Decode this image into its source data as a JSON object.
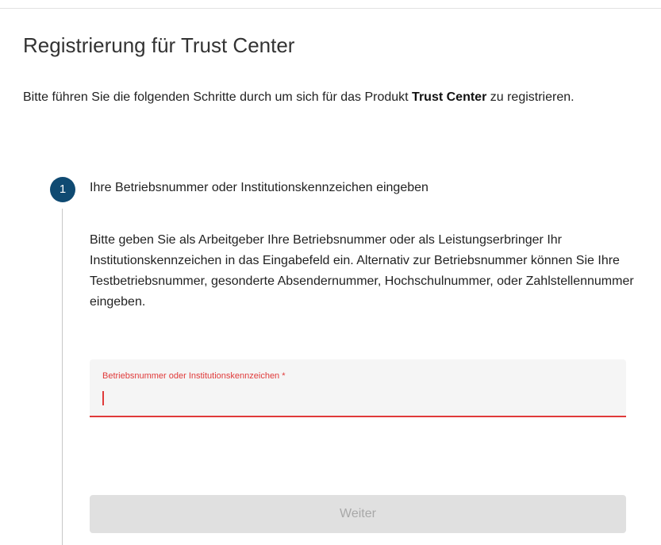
{
  "page": {
    "title": "Registrierung für Trust Center",
    "intro_text": "Bitte führen Sie die folgenden Schritte durch um sich für das Produkt ",
    "intro_product": "Trust Center",
    "intro_suffix": " zu registrieren."
  },
  "step": {
    "number": "1",
    "title": "Ihre Betriebsnummer oder Institutionskennzeichen eingeben",
    "description": "Bitte geben Sie als Arbeitgeber Ihre Betriebsnummer oder als Leistungserbringer Ihr Institutionskennzeichen in das Eingabefeld ein. Alternativ zur Betriebsnummer können Sie Ihre Testbetriebsnummer, gesonderte Absendernummer, Hochschulnummer, oder Zahlstellennummer eingeben.",
    "field": {
      "label": "Betriebsnummer oder Institutionskennzeichen *",
      "value": ""
    },
    "button_label": "Weiter"
  },
  "colors": {
    "step_badge": "#0f4a72",
    "error_accent": "#e03a3a",
    "button_disabled_bg": "#e0e0e0",
    "button_disabled_text": "#a8a8a8"
  }
}
